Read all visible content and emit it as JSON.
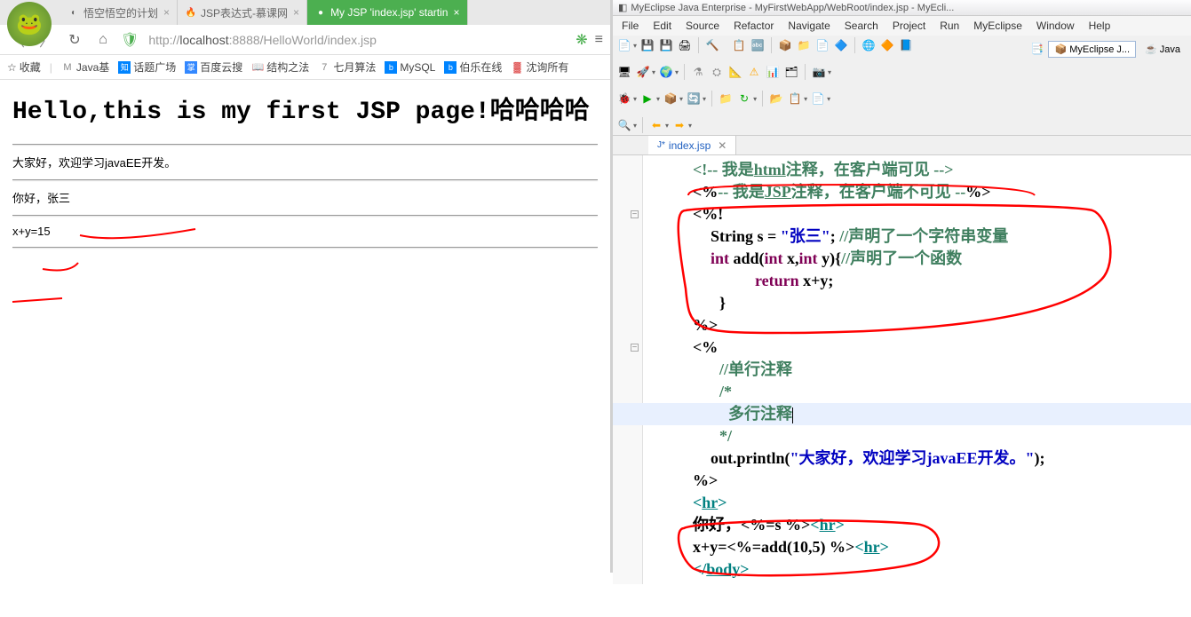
{
  "browser": {
    "tabs": [
      {
        "icon": "◐",
        "iconColor": "#666",
        "label": "悟空悟空的计划",
        "close": "×"
      },
      {
        "icon": "🔥",
        "iconColor": "#f50",
        "label": "JSP表达式-慕课网",
        "close": "×"
      },
      {
        "icon": "●",
        "iconColor": "#4caf50",
        "label": "My JSP 'index.jsp' startin",
        "close": "×",
        "active": true,
        "bg": "#4caf50",
        "textColor": "#fff"
      }
    ],
    "url_prefix": "http://",
    "url_host": "localhost",
    "url_rest": ":8888/HelloWorld/index.jsp"
  },
  "bookmarks": {
    "star": "☆",
    "star_label": "收藏",
    "items": [
      {
        "icon": "M",
        "iconColor": "#666",
        "label": "Java基"
      },
      {
        "icon": "知",
        "iconBg": "#0084ff",
        "label": "话题广场"
      },
      {
        "icon": "掌",
        "iconBg": "#3388ff",
        "label": "百度云搜"
      },
      {
        "icon": "📖",
        "iconColor": "#d49a6a",
        "label": "结构之法"
      },
      {
        "icon": "7",
        "iconColor": "#888",
        "label": "七月算法"
      },
      {
        "icon": "b",
        "iconBg": "#0084ff",
        "label": "MySQL"
      },
      {
        "icon": "b",
        "iconBg": "#0084ff",
        "label": "伯乐在线"
      },
      {
        "icon": "▓",
        "iconColor": "#d44",
        "label": "沈询所有"
      }
    ]
  },
  "page": {
    "title": "Hello,this is my first JSP page!哈哈哈哈",
    "line1": "大家好，欢迎学习javaEE开发。",
    "line2": "你好，张三",
    "line3": "x+y=15"
  },
  "ide": {
    "title": "MyEclipse Java Enterprise - MyFirstWebApp/WebRoot/index.jsp - MyEcli...",
    "menu": [
      "File",
      "Edit",
      "Source",
      "Refactor",
      "Navigate",
      "Search",
      "Project",
      "Run",
      "MyEclipse",
      "Window",
      "Help"
    ],
    "perspectives": [
      {
        "icon": "📦",
        "label": "MyEclipse J..."
      },
      {
        "icon": "☕",
        "label": "Java"
      }
    ],
    "editorTab": {
      "icon": "J*",
      "label": "index.jsp",
      "close": "✕"
    },
    "code": {
      "l1": "<!-- 我是",
      "l1b": "html",
      "l1c": "注释，在客户端可见 -->",
      "l2a": "<%",
      "l2b": "-- 我是",
      "l2c": "JSP",
      "l2d": "注释，在客户端不可见  --",
      "l2e": "%>",
      "l3": "<%!",
      "l4a": "String s = ",
      "l4b": "\"张三\"",
      "l4c": "; ",
      "l4d": "//声明了一个字符串变量",
      "l5a": "int",
      "l5b": " add(",
      "l5c": "int",
      "l5d": " x,",
      "l5e": "int",
      "l5f": " y){",
      "l5g": "//声明了一个函数",
      "l6a": "return",
      "l6b": " x+y;",
      "l7": "}",
      "l8": "%>",
      "l9": "<%",
      "l10": "//单行注释",
      "l11": "/*",
      "l12": "多行注释",
      "l13": "*/",
      "l14a": "out.println(",
      "l14b": "\"大家好，欢迎学习javaEE开发。\"",
      "l14c": ");",
      "l15": "%>",
      "l16a": "<",
      "l16b": "hr",
      "l16c": ">",
      "l17a": "你好，",
      "l17b": "<%=",
      "l17c": "s ",
      "l17d": "%>",
      "l17e": "<",
      "l17f": "hr",
      "l17g": ">",
      "l18a": "x+y=",
      "l18b": "<%=",
      "l18c": "add(10,5) ",
      "l18d": "%>",
      "l18e": "<",
      "l18f": "hr",
      "l18g": ">",
      "l19a": "</",
      "l19b": "body",
      "l19c": ">"
    }
  }
}
